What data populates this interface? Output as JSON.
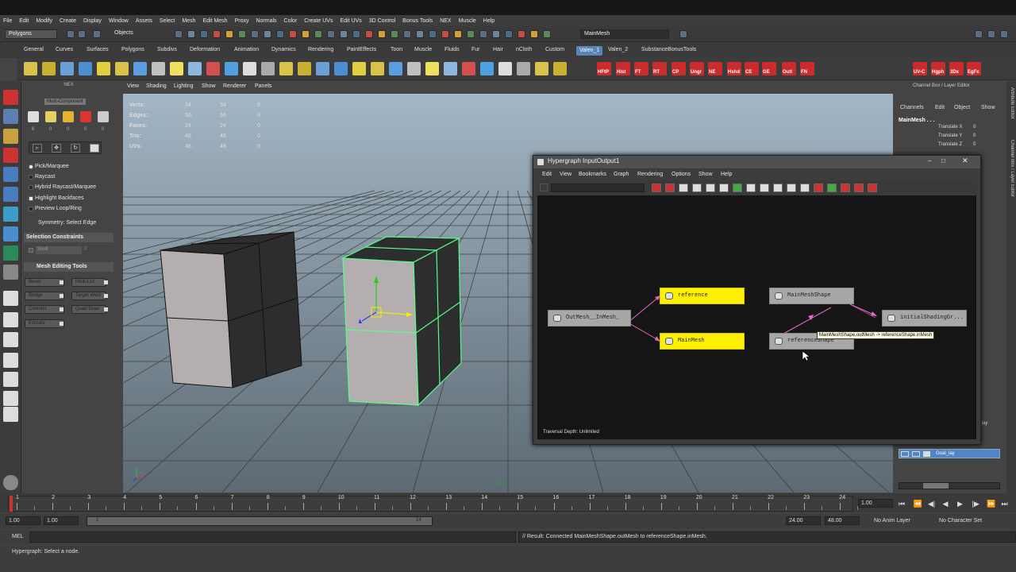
{
  "menu": [
    "File",
    "Edit",
    "Modify",
    "Create",
    "Display",
    "Window",
    "Assets",
    "Select",
    "Mesh",
    "Edit Mesh",
    "Proxy",
    "Normals",
    "Color",
    "Create UVs",
    "Edit UVs",
    "3D Control",
    "Bonus Tools",
    "NEX",
    "Muscle",
    "Help"
  ],
  "status": {
    "mode": "Polygons",
    "objects": "Objects",
    "name_field": "MainMesh"
  },
  "shelf_tabs": [
    "General",
    "Curves",
    "Surfaces",
    "Polygons",
    "Subdivs",
    "Deformation",
    "Animation",
    "Dynamics",
    "Rendering",
    "PaintEffects",
    "Toon",
    "Muscle",
    "Fluids",
    "Fur",
    "Hair",
    "nCloth",
    "Custom",
    "Valen_1",
    "Valen_2",
    "SubstanceBonusTools"
  ],
  "shelf_labels": [
    "HFtP",
    "Hist",
    "FT",
    "RT",
    "CP",
    "Ungr",
    "NE",
    "Hshd",
    "CE",
    "GE",
    "Outl",
    "FN",
    "UV-C",
    "Hgph",
    "3Dx",
    "EgFc"
  ],
  "nex": {
    "title": "NEX",
    "tooltip": "Multi-Component",
    "counts": [
      "6",
      "0",
      "0",
      "0",
      "0"
    ],
    "options": [
      "Pick/Marquee",
      "Raycast",
      "Hybrid Raycast/Marquee",
      "Highlight Backfaces",
      "Preview Loop/Ring"
    ],
    "symmetry": "Symmetry: Select Edge",
    "selection_constraints": "Selection Constraints",
    "shell": "Shell",
    "shell_val": "0",
    "mesh_editing_tools": "Mesh Editing Tools",
    "tools": [
      "Bevel",
      "Multi-Cut",
      "Bridge",
      "Target Weld",
      "Connect",
      "Quad Draw",
      "Extrude"
    ]
  },
  "viewport": {
    "menu": [
      "View",
      "Shading",
      "Lighting",
      "Show",
      "Renderer",
      "Panels"
    ],
    "hud": [
      {
        "label": "Verts:",
        "a": "34",
        "b": "34",
        "c": "0"
      },
      {
        "label": "Edges:",
        "a": "56",
        "b": "56",
        "c": "0"
      },
      {
        "label": "Faces:",
        "a": "24",
        "b": "24",
        "c": "0"
      },
      {
        "label": "Tris:",
        "a": "48",
        "b": "48",
        "c": "0"
      },
      {
        "label": "UVs:",
        "a": "48",
        "b": "48",
        "c": "0"
      }
    ],
    "camera": "persp"
  },
  "channelbox": {
    "title": "Channel Box / Layer Editor",
    "menu": [
      "Channels",
      "Edit",
      "Object",
      "Show"
    ],
    "object": "MainMesh . . .",
    "attrs": [
      {
        "name": "Translate X",
        "val": "0"
      },
      {
        "name": "Translate Y",
        "val": "0"
      },
      {
        "name": "Translate Z",
        "val": "0"
      }
    ],
    "layer": "Goal_lay",
    "layer_partial": "n_lay",
    "side_tabs": [
      "Attribute Editor",
      "Channel Box / Layer Editor"
    ]
  },
  "hypergraph": {
    "title": "Hypergraph InputOutput1",
    "menu": [
      "Edit",
      "View",
      "Bookmarks",
      "Graph",
      "Rendering",
      "Options",
      "Show",
      "Help"
    ],
    "nodes": {
      "outmesh": "OutMesh__InMesh_",
      "reference": "reference",
      "mainmesh": "MainMesh",
      "mainmeshshape": "MainMeshShape",
      "referenceshape": "referenceShape",
      "initialshading": "initialShadingGr..."
    },
    "tooltip": "MainMeshShape.outMesh -> referenceShape.inMesh",
    "traversal": "Traversal Depth: Unlimited"
  },
  "timeline": {
    "ticks": [
      "1",
      "2",
      "3",
      "4",
      "5",
      "6",
      "7",
      "8",
      "9",
      "10",
      "11",
      "12",
      "13",
      "14",
      "15",
      "16",
      "17",
      "18",
      "19",
      "20",
      "21",
      "22",
      "23",
      "24"
    ],
    "current": "1.00"
  },
  "range": {
    "start": "1.00",
    "start2": "1.00",
    "slider_start": "1",
    "slider_end": "24",
    "end": "24.00",
    "end2": "48.00",
    "anim_layer": "No Anim Layer",
    "char_set": "No Character Set"
  },
  "cmd": {
    "label": "MEL",
    "result": "// Result: Connected MainMeshShape.outMesh to referenceShape.inMesh."
  },
  "help": "Hypergraph: Select a node."
}
